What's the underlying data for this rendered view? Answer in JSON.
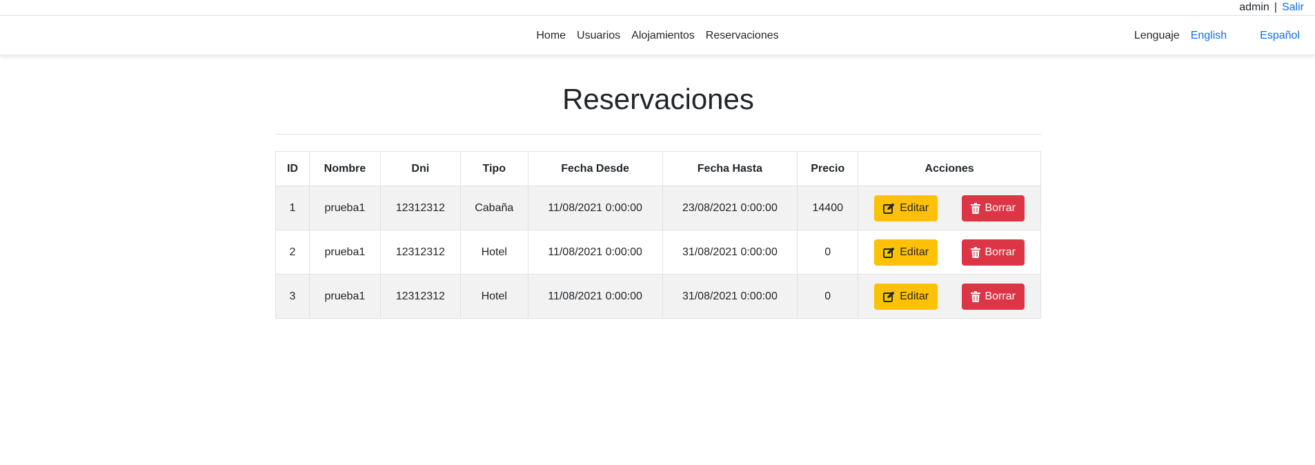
{
  "topbar": {
    "user": "admin",
    "separator": "|",
    "logout": "Salir"
  },
  "nav": {
    "items": [
      {
        "label": "Home"
      },
      {
        "label": "Usuarios"
      },
      {
        "label": "Alojamientos"
      },
      {
        "label": "Reservaciones"
      }
    ],
    "language_label": "Lenguaje",
    "english": "English",
    "spanish": "Español"
  },
  "page": {
    "title": "Reservaciones"
  },
  "table": {
    "headers": [
      "ID",
      "Nombre",
      "Dni",
      "Tipo",
      "Fecha Desde",
      "Fecha Hasta",
      "Precio",
      "Acciones"
    ],
    "rows": [
      {
        "id": "1",
        "nombre": "prueba1",
        "dni": "12312312",
        "tipo": "Cabaña",
        "desde": "11/08/2021 0:00:00",
        "hasta": "23/08/2021 0:00:00",
        "precio": "14400"
      },
      {
        "id": "2",
        "nombre": "prueba1",
        "dni": "12312312",
        "tipo": "Hotel",
        "desde": "11/08/2021 0:00:00",
        "hasta": "31/08/2021 0:00:00",
        "precio": "0"
      },
      {
        "id": "3",
        "nombre": "prueba1",
        "dni": "12312312",
        "tipo": "Hotel",
        "desde": "11/08/2021 0:00:00",
        "hasta": "31/08/2021 0:00:00",
        "precio": "0"
      }
    ],
    "edit_label": "Editar",
    "delete_label": "Borrar",
    "edit_icon": "edit-icon",
    "delete_icon": "trash-icon"
  },
  "colors": {
    "warning": "#ffc107",
    "danger": "#dc3545",
    "link": "#0d6efd"
  }
}
